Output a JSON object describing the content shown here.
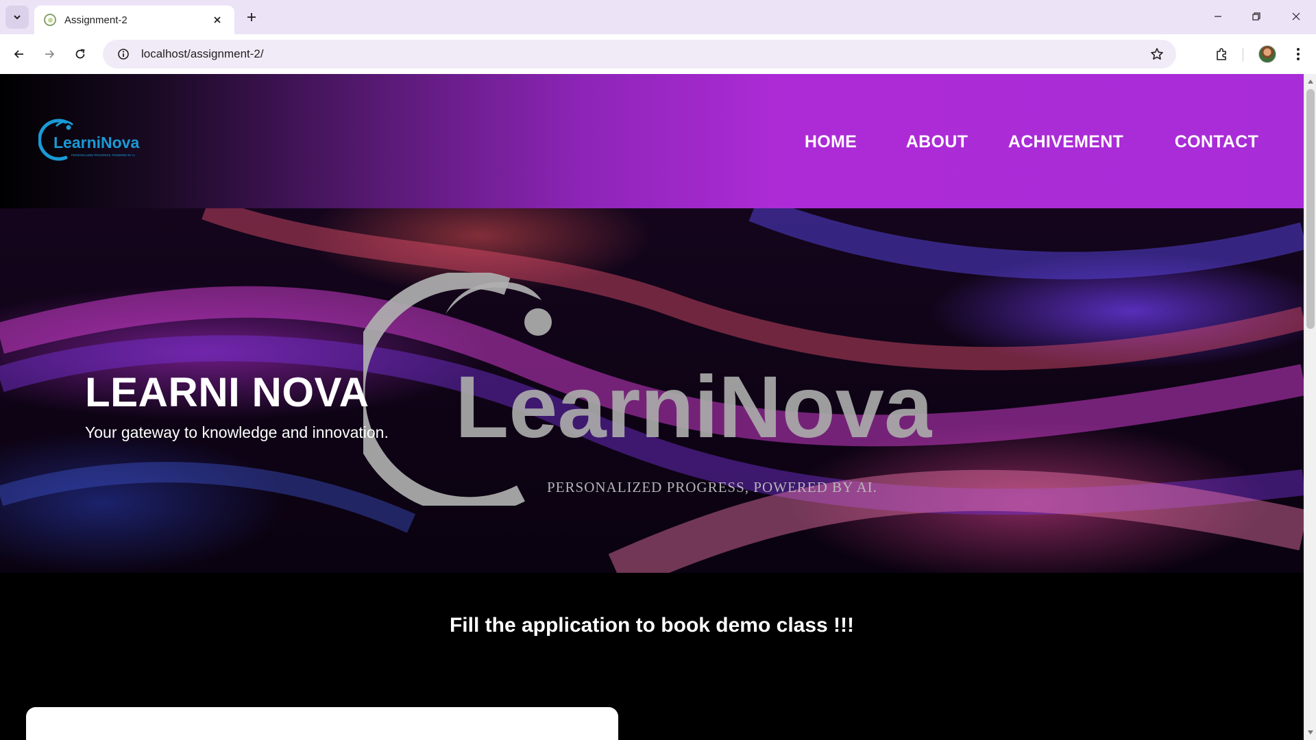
{
  "browser": {
    "tab_title": "Assignment-2",
    "url": "localhost/assignment-2/"
  },
  "site": {
    "logo_text": "LearniNova",
    "logo_tagline": "PERSONALIZED PROGRESS, POWERED BY AI",
    "nav": [
      "HOME",
      "ABOUT",
      "ACHIVEMENT",
      "CONTACT"
    ]
  },
  "hero": {
    "title": "LEARNI NOVA",
    "subtitle": "Your gateway to knowledge and innovation.",
    "watermark_text": "LearniNova",
    "watermark_tagline": "PERSONALIZED PROGRESS, POWERED BY AI."
  },
  "cta": {
    "title": "Fill the application to book demo class !!!"
  },
  "colors": {
    "header_gradient_end": "#a82cd8",
    "logo_blue": "#1a9ad6",
    "tab_strip": "#ece3f7"
  }
}
